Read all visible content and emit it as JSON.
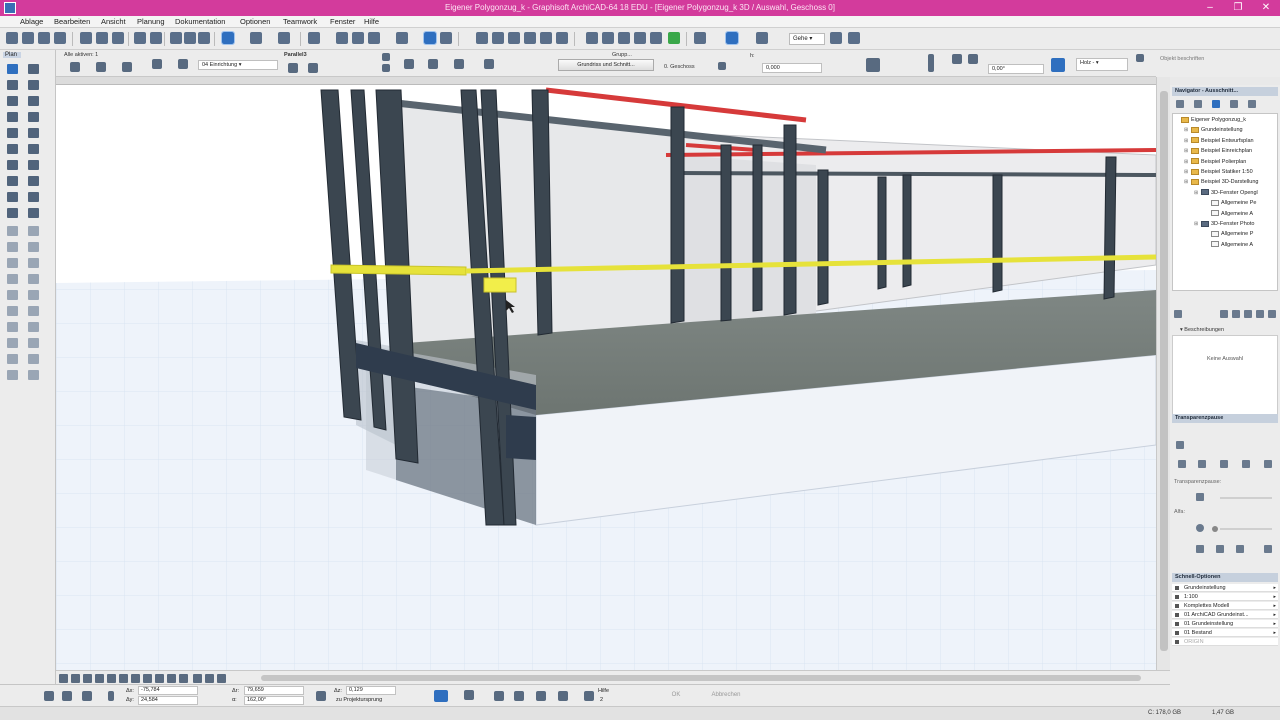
{
  "window": {
    "title": "Eigener Polygonzug_k - Graphisoft ArchiCAD-64 18 EDU - [Eigener Polygonzug_k 3D / Auswahl, Geschoss 0]",
    "controls": [
      "–",
      "❐",
      "✕"
    ]
  },
  "menu": [
    "Ablage",
    "Bearbeiten",
    "Ansicht",
    "Planung",
    "Dokumentation",
    "Optionen",
    "Teamwork",
    "Fenster",
    "Hilfe"
  ],
  "toolbar": {
    "dropdown_label": "Gehe"
  },
  "infobox": {
    "selection_label": "Alle aktiven: 1",
    "layer_value": "04 Einrichtung",
    "projection_label": "Parallel3",
    "plan_button": "Grundriss und Schnitt...",
    "group_label": "Grupp...",
    "storey_value": "0. Geschoss",
    "height_label": "h:",
    "height_value": "0,000",
    "angle_value": "0,00°",
    "material_value": "Holz -",
    "object_label": "Objekt beschriften"
  },
  "toolbox": {
    "label": "Plan"
  },
  "navigator": {
    "title": "Navigator - Ausschnitt...",
    "tree": [
      {
        "label": "Eigener Polygonzug_k",
        "level": 0,
        "type": "folder"
      },
      {
        "label": "Grundeinstellung",
        "level": 1,
        "type": "folder"
      },
      {
        "label": "Beispiel Entwurfsplan",
        "level": 1,
        "type": "folder"
      },
      {
        "label": "Beispiel Einreichplan",
        "level": 1,
        "type": "folder"
      },
      {
        "label": "Beispiel Polierplan",
        "level": 1,
        "type": "folder"
      },
      {
        "label": "Beispiel Statiker 1:50",
        "level": 1,
        "type": "folder"
      },
      {
        "label": "Beispiel 3D-Darstellung",
        "level": 1,
        "type": "folder"
      },
      {
        "label": "3D-Fenster Opengl",
        "level": 2,
        "type": "view"
      },
      {
        "label": "Allgemeine Pe",
        "level": 3,
        "type": "doc"
      },
      {
        "label": "Allgemeine A",
        "level": 3,
        "type": "doc"
      },
      {
        "label": "3D-Fenster Photo",
        "level": 2,
        "type": "view"
      },
      {
        "label": "Allgemeine P",
        "level": 3,
        "type": "doc"
      },
      {
        "label": "Allgemeine A",
        "level": 3,
        "type": "doc"
      }
    ]
  },
  "description_panel": {
    "heading": "Beschreibungen",
    "empty_text": "Keine Auswahl"
  },
  "transparency_panel": {
    "title": "Transparenzpause",
    "pause_label": "Transparenzpause:",
    "alpha_label": "Alfa:"
  },
  "schnell_panel": {
    "title": "Schnell-Optionen",
    "rows": [
      "Grundeinstellung",
      "1:100",
      "Komplettes Modell",
      "01 ArchiCAD Grundeinst...",
      "01 Grundeinstellung",
      "01 Bestand",
      "ORIGIN"
    ]
  },
  "coords": {
    "dx_label": "Δx:",
    "dx": "-75,784",
    "dy_label": "Δy:",
    "dy": "24,584",
    "r_label": "Δr:",
    "r": "79,659",
    "a_label": "α:",
    "a": "162,00°",
    "dz_label": "Δz:",
    "dz": "0,129",
    "z_ref": "zu Projektursprung",
    "help_label": "Hilfe",
    "help_value": "2",
    "ok_button": "OK",
    "cancel_button": "Abbrechen"
  },
  "status": {
    "drive": "C: 178,0 GB",
    "memory": "1,47 GB"
  },
  "colors": {
    "titlebar": "#d33b9c",
    "steel": "#3b4650",
    "railing_red": "#d63a3a",
    "highlight_yellow": "#e6e23a",
    "ground": "#eef3fa"
  }
}
